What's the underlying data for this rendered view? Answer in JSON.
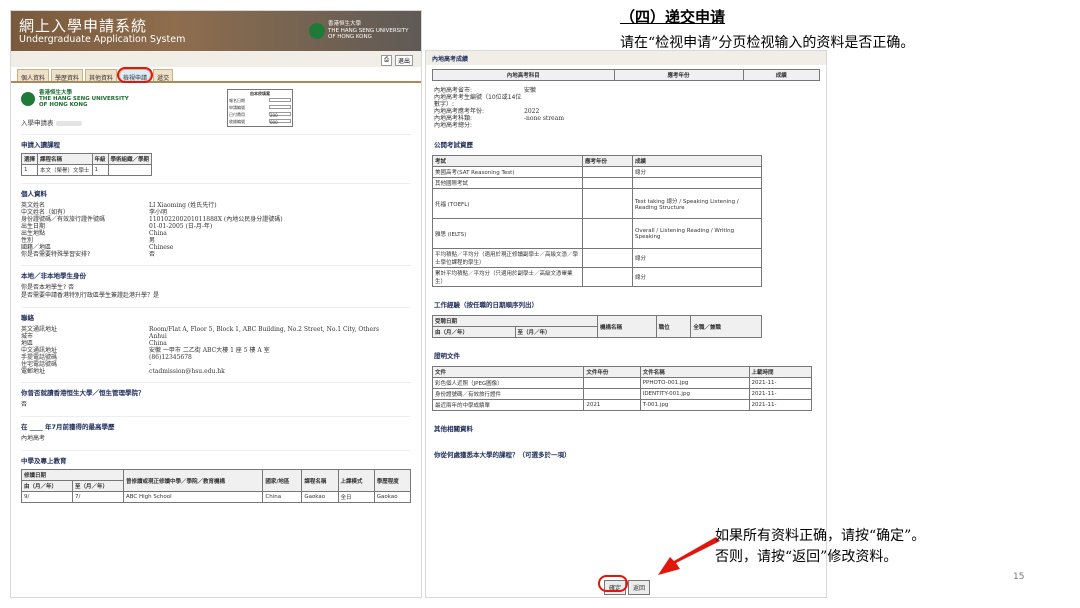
{
  "left": {
    "title": "網上入學申請系統",
    "subtitle": "Undergraduate Application System",
    "university_cn": "香港恒生大學",
    "university_en1": "THE HANG SENG UNIVERSITY",
    "university_en2": "OF HONG KONG",
    "tabs": [
      "個人資料",
      "學歷資料",
      "其他資料",
      "檢視申請",
      "遞交",
      "退出"
    ],
    "applicant_label": "入學申請表",
    "infobox_title": "由本校填寫",
    "infobox_rows": [
      "報名日期",
      "申請編號",
      "已付費用",
      "收據編號"
    ],
    "infobox_values": [
      "",
      "",
      "200",
      "000"
    ],
    "sec_programme": "申請入讀課程",
    "programme_headers": [
      "選擇",
      "課程名稱",
      "年級",
      "學術組織／學期"
    ],
    "programme_row": [
      "1",
      "本文（榮譽）文學士",
      "1",
      ""
    ],
    "sec_personal": "個人資料",
    "personal": [
      [
        "英文姓名",
        "LI Xiaoming (姓氏先行)"
      ],
      [
        "中文姓名（如有）",
        "李小明"
      ],
      [
        "身份證號碼／有效旅行證件號碼",
        "110102200201011888X (內地公民身分證號碼)"
      ],
      [
        "出生日期",
        "01-01-2005 (日-月-年)"
      ],
      [
        "出生地點",
        "China"
      ],
      [
        "性別",
        "男"
      ],
      [
        "國籍／地區",
        "Chinese"
      ],
      [
        "你是否需要特殊學習安排?",
        "否"
      ]
    ],
    "sec_local": "本地／非本地學生身份",
    "local_q1": "你是否本地學生?",
    "local_a1": "否",
    "local_q2": "是否需要申請香港特別行政區學生簽證赴港升學？是",
    "sec_contact": "聯絡",
    "contact": [
      [
        "英文通訊地址",
        "Room/Flat A, Floor 5, Block 1, ABC Building, No.2 Street, No.1 City, Others"
      ],
      [
        "城市",
        "Anhui"
      ],
      [
        "地區",
        "China"
      ],
      [
        "中文通訊地址",
        "安徽 一甲市 二乙街 ABC大樓 1 座 5 樓 A 室"
      ],
      [
        "手提電話號碼",
        "(86)12345678"
      ],
      [
        "住宅電話號碼",
        "-"
      ],
      [
        "電郵地址",
        "ctadmission@hsu.edu.hk"
      ]
    ],
    "sec_q": "你曾否就讀香港恒生大學／恒生管理學院？",
    "q_answer": "否",
    "sec_year": "在 ____ 年7月前獲得的最高學歷",
    "year_answer": "內地高考",
    "sec_edu": "中學及專上教育",
    "edu_headers": [
      "修讀日期",
      "曾修讀或現正修讀中學／學院／教育機構",
      "國家/地區",
      "課程名稱",
      "上課模式",
      "學歷程度"
    ],
    "edu_sub": [
      "由（月／年）",
      "至（月／年）"
    ],
    "edu_row": [
      "9/",
      "7/",
      "ABC High School",
      "China",
      "Gaokao",
      "全日",
      "Gaokao"
    ]
  },
  "right": {
    "gaokao_header": "內地高考成績",
    "gaokao_cols": [
      "內地高考科目",
      "應考年份",
      "成績"
    ],
    "gaokao_info": [
      [
        "內地高考省市:",
        "安徽"
      ],
      [
        "內地高考考生編號（10位或14位數字）:",
        ""
      ],
      [
        "內地高考應考年份:",
        "2022"
      ],
      [
        "內地高考科類:",
        "-none stream"
      ],
      [
        "內地高考總分:",
        ""
      ]
    ],
    "public_header": "公開考試資歷",
    "public_cols": [
      "考試",
      "應考年份",
      "成績"
    ],
    "public_rows": [
      [
        "美國高考(SAT Reasoning Test)",
        "",
        "總分"
      ],
      [
        "其他國際考試",
        "",
        ""
      ],
      [
        "托福 (TOEFL)",
        "",
        "Test taking 總分 / Speaking Listening / Reading Structure"
      ],
      [
        "雅思 (IELTS)",
        "",
        "Overall / Listening Reading / Writing Speaking"
      ],
      [
        "平均積點／平均分（適用於現正修讀副學士／高級文憑／學士學位課程的學生）",
        "",
        "總分"
      ],
      [
        "累計平均積點／平均分（只適用於副學士／高級文憑畢業生）",
        "",
        "總分"
      ]
    ],
    "work_header": "工作經驗（按任職的日期順序列出）",
    "work_cols": [
      "受聘日期",
      "機構名稱",
      "職位",
      "全職／兼職"
    ],
    "work_sub": [
      "由（月／年）",
      "至（月／年）"
    ],
    "docs_header": "證明文件",
    "docs_cols": [
      "文件",
      "文件年份",
      "文件名稱",
      "上載時間"
    ],
    "docs_rows": [
      [
        "彩色個人近照（JPEG圖像）",
        "",
        "PPHOTO-001.jpg",
        "2021-11-"
      ],
      [
        "身份證號碼／有效旅行證件",
        "",
        "IDENTITY-001.jpg",
        "2021-11-"
      ],
      [
        "最近兩年的中學成績單",
        "2021",
        "T-001.jpg",
        "2021-11-"
      ]
    ],
    "other_header": "其他相關資料",
    "learn_header": "你從何處獲悉本大學的課程？（可選多於一項）",
    "confirm": "確定",
    "back": "返回"
  },
  "annotation": {
    "title": "（四）递交申请",
    "subtitle": "请在“检视申请”分页检视输入的资料是否正确。",
    "bottom1": "如果所有资料正确，请按“确定”。",
    "bottom2": "否则，请按“返回”修改资料。",
    "page_number": "15"
  }
}
